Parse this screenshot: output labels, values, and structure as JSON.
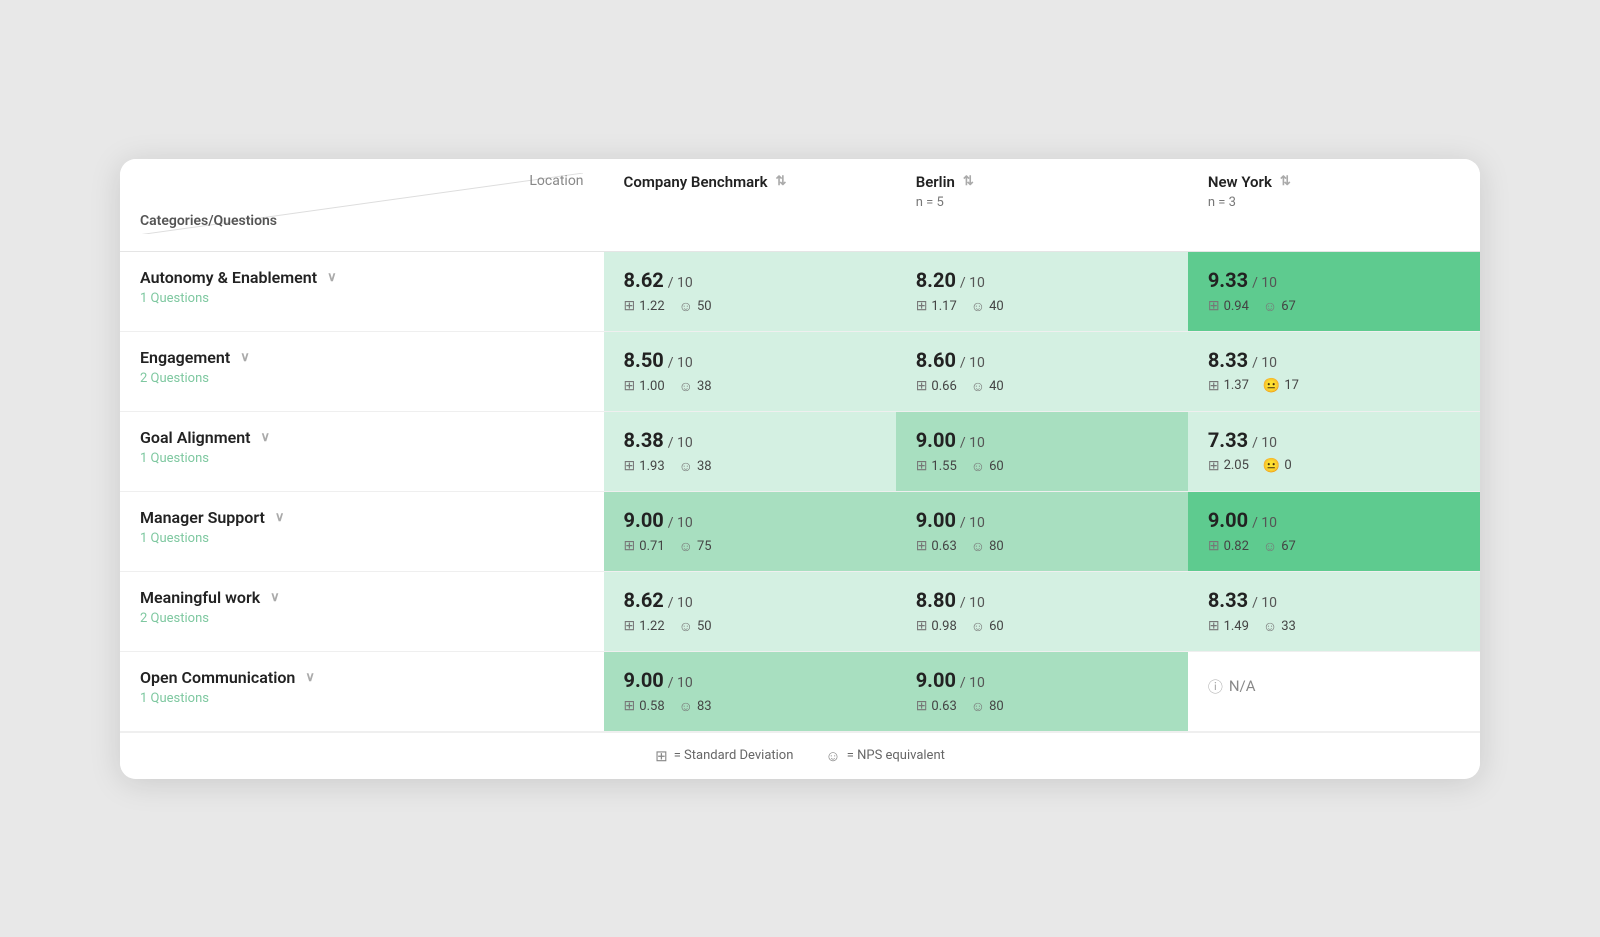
{
  "header": {
    "col_location": "Location",
    "col_categories": "Categories/Questions",
    "columns": [
      {
        "label": "Company Benchmark",
        "sub": "",
        "sort": true
      },
      {
        "label": "Berlin",
        "sub": "n = 5",
        "sort": true
      },
      {
        "label": "New York",
        "sub": "n = 3",
        "sort": true
      }
    ]
  },
  "rows": [
    {
      "category": "Autonomy & Enablement",
      "questions": "1 Questions",
      "cells": [
        {
          "score": "8.62",
          "denom": "10",
          "std": "1.22",
          "nps": "50",
          "bg": "light-green"
        },
        {
          "score": "8.20",
          "denom": "10",
          "std": "1.17",
          "nps": "40",
          "bg": "light-green"
        },
        {
          "score": "9.33",
          "denom": "10",
          "std": "0.94",
          "nps": "67",
          "bg": "dark-green"
        }
      ]
    },
    {
      "category": "Engagement",
      "questions": "2 Questions",
      "cells": [
        {
          "score": "8.50",
          "denom": "10",
          "std": "1.00",
          "nps": "38",
          "bg": "light-green"
        },
        {
          "score": "8.60",
          "denom": "10",
          "std": "0.66",
          "nps": "40",
          "bg": "light-green"
        },
        {
          "score": "8.33",
          "denom": "10",
          "std": "1.37",
          "nps": "17",
          "bg": "light-green",
          "nps_neutral": true
        }
      ]
    },
    {
      "category": "Goal Alignment",
      "questions": "1 Questions",
      "cells": [
        {
          "score": "8.38",
          "denom": "10",
          "std": "1.93",
          "nps": "38",
          "bg": "light-green"
        },
        {
          "score": "9.00",
          "denom": "10",
          "std": "1.55",
          "nps": "60",
          "bg": "medium-green"
        },
        {
          "score": "7.33",
          "denom": "10",
          "std": "2.05",
          "nps": "0",
          "bg": "light-green",
          "nps_neutral": true
        }
      ]
    },
    {
      "category": "Manager Support",
      "questions": "1 Questions",
      "cells": [
        {
          "score": "9.00",
          "denom": "10",
          "std": "0.71",
          "nps": "75",
          "bg": "medium-green"
        },
        {
          "score": "9.00",
          "denom": "10",
          "std": "0.63",
          "nps": "80",
          "bg": "medium-green"
        },
        {
          "score": "9.00",
          "denom": "10",
          "std": "0.82",
          "nps": "67",
          "bg": "dark-green"
        }
      ]
    },
    {
      "category": "Meaningful work",
      "questions": "2 Questions",
      "cells": [
        {
          "score": "8.62",
          "denom": "10",
          "std": "1.22",
          "nps": "50",
          "bg": "light-green"
        },
        {
          "score": "8.80",
          "denom": "10",
          "std": "0.98",
          "nps": "60",
          "bg": "light-green"
        },
        {
          "score": "8.33",
          "denom": "10",
          "std": "1.49",
          "nps": "33",
          "bg": "light-green"
        }
      ]
    },
    {
      "category": "Open Communication",
      "questions": "1 Questions",
      "cells": [
        {
          "score": "9.00",
          "denom": "10",
          "std": "0.58",
          "nps": "83",
          "bg": "medium-green"
        },
        {
          "score": "9.00",
          "denom": "10",
          "std": "0.63",
          "nps": "80",
          "bg": "medium-green"
        },
        {
          "score": null,
          "na": true,
          "bg": "white"
        }
      ]
    }
  ],
  "legend": {
    "std_label": "= Standard Deviation",
    "nps_label": "= NPS equivalent"
  }
}
